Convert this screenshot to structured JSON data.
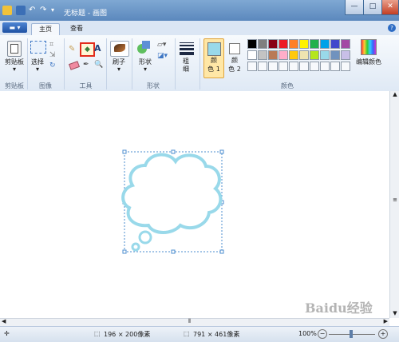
{
  "window": {
    "title": "无标题 - 画图",
    "minimize_label": "—",
    "maximize_label": "□",
    "close_label": "✕"
  },
  "ribbon_tabs": [
    {
      "label": "主页"
    },
    {
      "label": "查看"
    }
  ],
  "groups": {
    "clipboard": {
      "label": "剪贴板"
    },
    "image": {
      "label": "图像",
      "select_label": "选择"
    },
    "tools": {
      "label": "工具",
      "text_tool": "A"
    },
    "brushes": {
      "label": "刷子"
    },
    "shapes": {
      "label": "形状",
      "shapes_label": "形状"
    },
    "size": {
      "label": "粗细"
    },
    "colors": {
      "label": "颜色",
      "color1_line1": "颜",
      "color1_line2": "色 1",
      "color2_line1": "颜",
      "color2_line2": "色 2",
      "edit_colors": "编辑颜色",
      "palette_row1": [
        "#000000",
        "#7f7f7f",
        "#880015",
        "#ed1c24",
        "#ff7f27",
        "#fff200",
        "#22b14c",
        "#00a2e8",
        "#3f48cc",
        "#a349a4"
      ],
      "palette_row2": [
        "#ffffff",
        "#c3c3c3",
        "#b97a57",
        "#ffaec9",
        "#ffc90e",
        "#efe4b0",
        "#b5e61d",
        "#99d9ea",
        "#7092be",
        "#c8bfe7"
      ],
      "color1": "#99d9ea",
      "color2": "#ffffff"
    }
  },
  "status": {
    "selection_size": "196 × 200像素",
    "image_size": "791 × 461像素",
    "zoom": "100%"
  },
  "watermark": "Baidu经验"
}
